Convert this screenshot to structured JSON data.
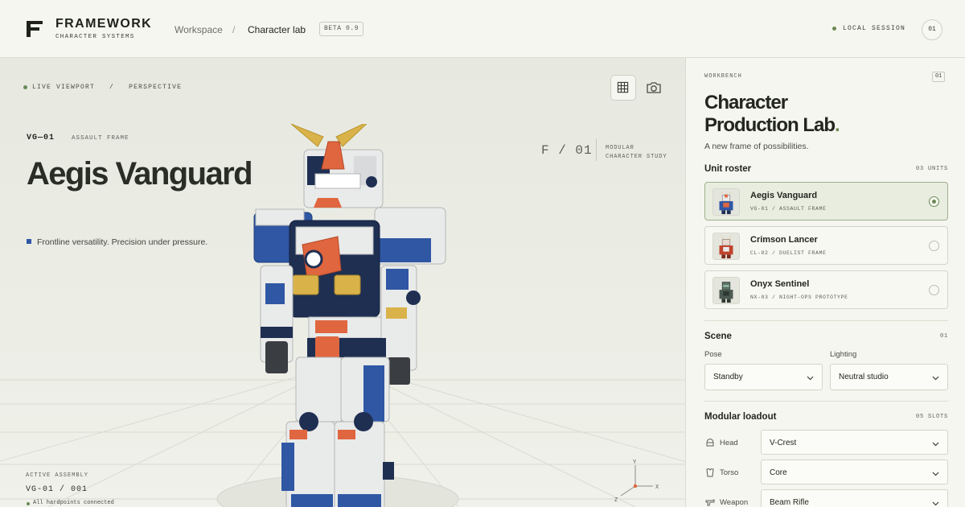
{
  "header": {
    "brand": "FRAMEWORK",
    "brand_sub": "CHARACTER SYSTEMS",
    "breadcrumb": [
      "Workspace",
      "Character lab"
    ],
    "breadcrumb_sep": "/",
    "badge": "BETA 0.9",
    "session": "LOCAL SESSION",
    "user": "01"
  },
  "viewport": {
    "mode": "LIVE VIEWPORT",
    "sep": "/",
    "projection": "PERSPECTIVE",
    "unit_code": "VG—01",
    "unit_class": "ASSAULT FRAME",
    "unit_name": "Aegis Vanguard",
    "tagline": "Frontline versatility. Precision under pressure.",
    "frame_no": "F / 01",
    "frame_desc_1": "MODULAR",
    "frame_desc_2": "CHARACTER STUDY",
    "assembly_label": "ACTIVE ASSEMBLY",
    "assembly_code": "VG-01 / 001",
    "assembly_status": "All hardpoints connected",
    "axes": {
      "x": "X",
      "y": "Y",
      "z": "Z"
    },
    "tools": [
      "grid-icon",
      "camera-icon"
    ]
  },
  "panel": {
    "label": "WORKBENCH",
    "badge": "01",
    "title_1": "Character",
    "title_2": "Production Lab",
    "title_dot": ".",
    "subtitle": "A new frame of possibilities.",
    "roster": {
      "title": "Unit roster",
      "meta": "03 UNITS",
      "items": [
        {
          "name": "Aegis Vanguard",
          "code": "VG-01 / ASSAULT FRAME",
          "selected": true
        },
        {
          "name": "Crimson Lancer",
          "code": "CL-02 / DUELIST FRAME",
          "selected": false
        },
        {
          "name": "Onyx Sentinel",
          "code": "NX-03 / NIGHT-OPS PROTOTYPE",
          "selected": false
        }
      ]
    },
    "scene": {
      "title": "Scene",
      "meta": "01",
      "pose_label": "Pose",
      "pose_value": "Standby",
      "lighting_label": "Lighting",
      "lighting_value": "Neutral studio"
    },
    "loadout": {
      "title": "Modular loadout",
      "meta": "05 SLOTS",
      "slots": [
        {
          "label": "Head",
          "value": "V-Crest",
          "icon": "helmet-icon"
        },
        {
          "label": "Torso",
          "value": "Core",
          "icon": "torso-icon"
        },
        {
          "label": "Weapon",
          "value": "Beam Rifle",
          "icon": "weapon-icon"
        }
      ]
    }
  },
  "colors": {
    "accent": "#6b8a55",
    "primary_blue": "#2f57a4",
    "navy": "#1f2f52",
    "orange": "#e0663f",
    "gold": "#d9b34a"
  }
}
